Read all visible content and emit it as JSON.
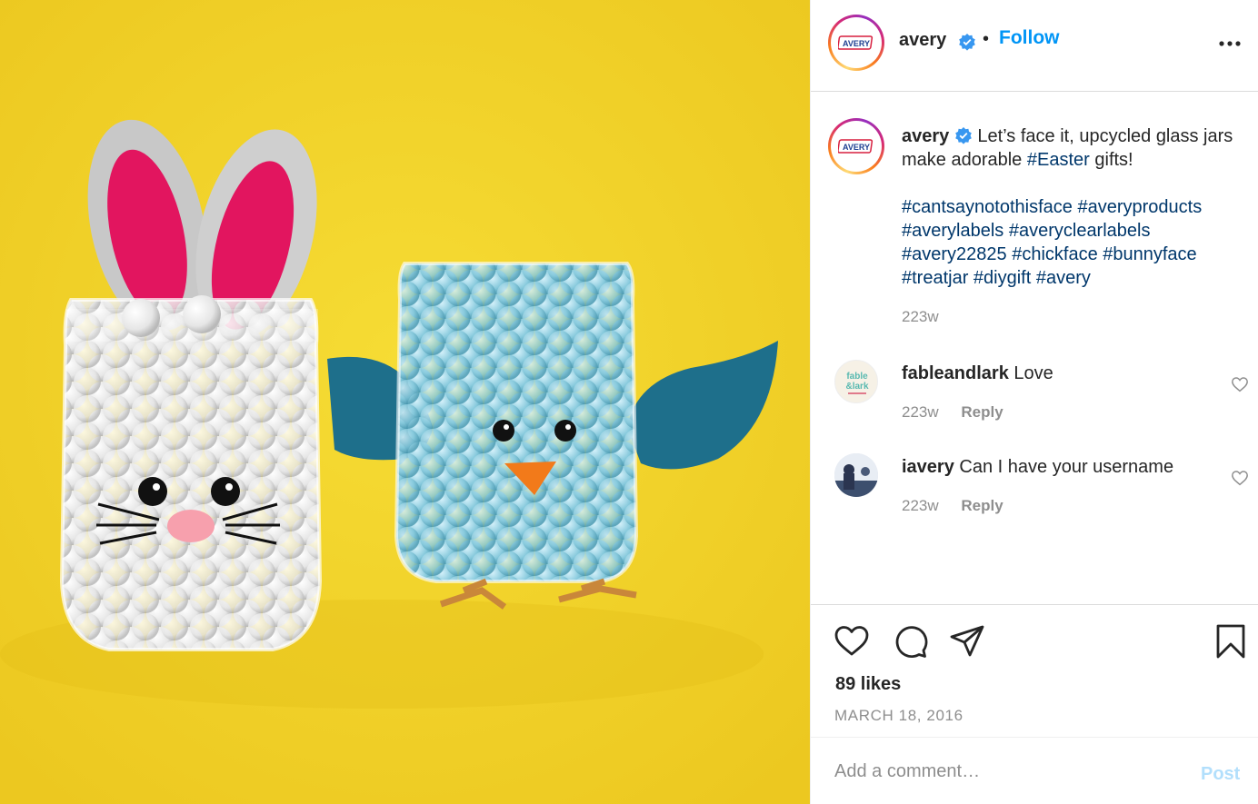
{
  "post": {
    "username": "avery",
    "follow_label": "Follow",
    "separator": "•",
    "avatar_text": "AVERY",
    "caption_main": "Let’s face it, upcycled glass jars make adorable",
    "caption_hashtag": "#Easter",
    "caption_tail": "gifts!",
    "caption_tags": "#cantsaynotothisface #averyproducts #averylabels #averyclearlabels #avery22825 #chickface #bunnyface #treatjar #diygift #avery",
    "caption_time": "223w",
    "likes": "89 likes",
    "date": "MARCH 18, 2016"
  },
  "comments": [
    {
      "username": "fableandlark",
      "text": "Love",
      "time": "223w",
      "reply_label": "Reply",
      "avatar_text": "fable & lark"
    },
    {
      "username": "iavery",
      "text": "Can I have your username",
      "time": "223w",
      "reply_label": "Reply"
    }
  ],
  "add_comment": {
    "placeholder": "Add a comment…",
    "post_label": "Post"
  },
  "icons": [
    "verified-badge-icon",
    "more-options-icon",
    "like-icon",
    "comment-icon",
    "share-icon",
    "save-icon",
    "comment-like-icon"
  ],
  "colors": {
    "accent": "#0095f6",
    "hashtag": "#00376b",
    "muted": "#8e8e8e",
    "background_photo": "#f2d52c"
  }
}
